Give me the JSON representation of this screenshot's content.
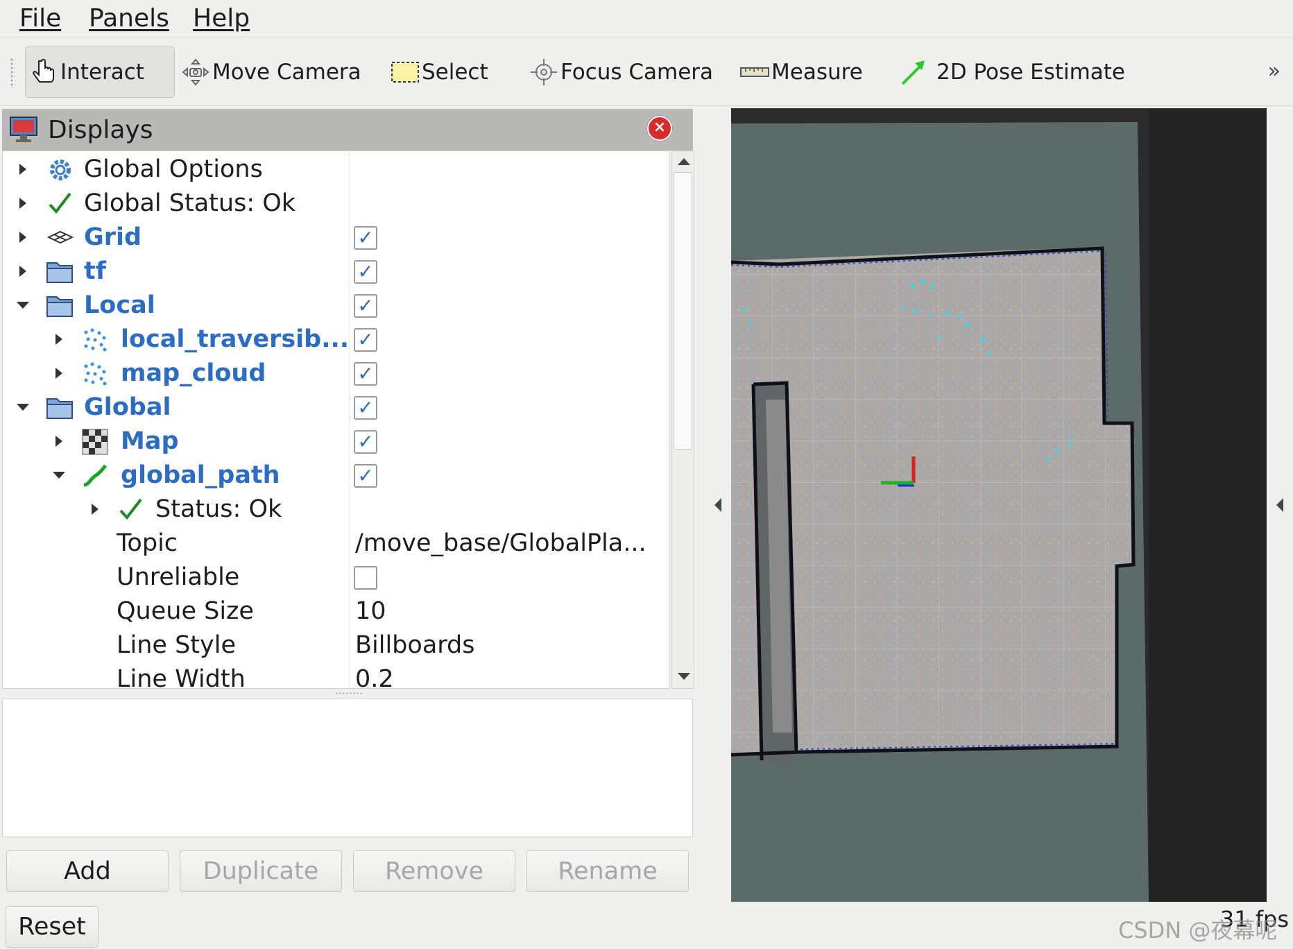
{
  "menu": {
    "file": "File",
    "panels": "Panels",
    "help": "Help"
  },
  "toolbar": {
    "interact": "Interact",
    "move_camera": "Move Camera",
    "select": "Select",
    "focus_camera": "Focus Camera",
    "measure": "Measure",
    "pose_estimate": "2D Pose Estimate",
    "more": "»"
  },
  "displays": {
    "title": "Displays",
    "items": {
      "global_options": "Global Options",
      "global_status": "Global Status: Ok",
      "grid": "Grid",
      "tf": "tf",
      "local": "Local",
      "local_traversable": "local_traversib...",
      "map_cloud": "map_cloud",
      "global": "Global",
      "map": "Map",
      "global_path": "global_path",
      "status": "Status: Ok"
    },
    "properties": {
      "topic_label": "Topic",
      "topic_value": "/move_base/GlobalPla...",
      "unreliable_label": "Unreliable",
      "queue_size_label": "Queue Size",
      "queue_size_value": "10",
      "line_style_label": "Line Style",
      "line_style_value": "Billboards",
      "line_width_label": "Line Width",
      "line_width_value": "0.2"
    },
    "checked": {
      "grid": true,
      "tf": true,
      "local": true,
      "local_traversable": true,
      "map_cloud": true,
      "global": true,
      "map": true,
      "global_path": true,
      "unreliable": false
    }
  },
  "buttons": {
    "add": "Add",
    "duplicate": "Duplicate",
    "remove": "Remove",
    "rename": "Rename",
    "reset": "Reset"
  },
  "status": {
    "fps": "31 fps",
    "watermark": "CSDN @夜幕呢"
  },
  "colors": {
    "accent_blue": "#2b6cc4",
    "map_free": "#a9a9a9",
    "map_unknown": "#5c6b69",
    "close_red": "#d92b2b"
  }
}
